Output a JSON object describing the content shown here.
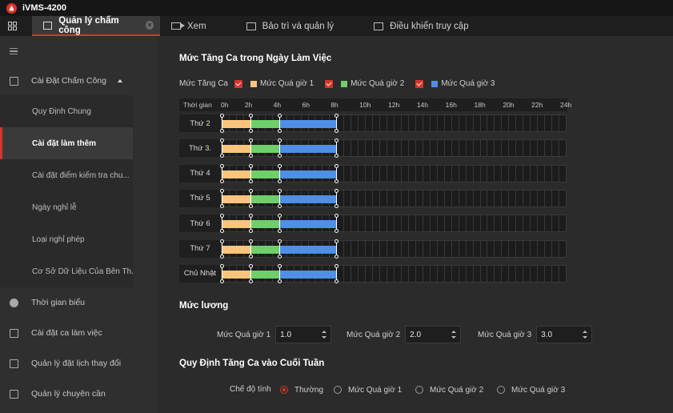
{
  "app": {
    "title": "iVMS-4200"
  },
  "tabs": [
    {
      "label": "Quản lý chấm công",
      "icon": "calendar-icon",
      "active": true
    },
    {
      "label": "Xem",
      "icon": "camera-icon"
    },
    {
      "label": "Bảo trì và quản lý",
      "icon": "maintenance-icon"
    },
    {
      "label": "Điều khiển truy cập",
      "icon": "access-control-icon"
    }
  ],
  "sidebar": {
    "groups": [
      {
        "label": "Cài Đặt Chấm Công",
        "icon": "calendar-icon",
        "expanded": true
      },
      {
        "label": "Thời gian biểu",
        "icon": "clock-icon"
      },
      {
        "label": "Cài đặt ca làm việc",
        "icon": "shift-icon"
      },
      {
        "label": "Quản lý đặt lịch thay đổi",
        "icon": "schedule-icon"
      },
      {
        "label": "Quản lý chuyên cần",
        "icon": "attendance-icon"
      }
    ],
    "sub_items": [
      {
        "label": "Quy Định Chung"
      },
      {
        "label": "Cài đặt làm thêm",
        "active": true
      },
      {
        "label": "Cài đặt điểm kiểm tra chu..."
      },
      {
        "label": "Ngày nghỉ lễ"
      },
      {
        "label": "Loại nghỉ phép"
      },
      {
        "label": "Cơ Sở Dữ Liệu Của Bên Th..."
      }
    ]
  },
  "overtime": {
    "title": "Mức Tăng Ca trong Ngày Làm Việc",
    "legend_label": "Mức Tăng Ca",
    "levels": [
      {
        "label": "Mức Quá giờ 1",
        "color": "#f9c57c",
        "checked": true
      },
      {
        "label": "Mức Quá giờ 2",
        "color": "#6fcf6a",
        "checked": true
      },
      {
        "label": "Mức Quá giờ 3",
        "color": "#4f8fe6",
        "checked": true
      }
    ],
    "axis_title": "Thời gian",
    "hours": [
      "0h",
      "2h",
      "4h",
      "6h",
      "8h",
      "10h",
      "12h",
      "14h",
      "16h",
      "18h",
      "20h",
      "22h",
      "24h"
    ],
    "days": [
      {
        "name": "Thứ 2",
        "segments": [
          [
            0,
            2,
            0
          ],
          [
            2,
            4,
            1
          ],
          [
            4,
            8,
            2
          ]
        ]
      },
      {
        "name": "Thứ 3.",
        "segments": [
          [
            0,
            2,
            0
          ],
          [
            2,
            4,
            1
          ],
          [
            4,
            8,
            2
          ]
        ]
      },
      {
        "name": "Thứ 4",
        "segments": [
          [
            0,
            2,
            0
          ],
          [
            2,
            4,
            1
          ],
          [
            4,
            8,
            2
          ]
        ]
      },
      {
        "name": "Thứ 5",
        "segments": [
          [
            0,
            2,
            0
          ],
          [
            2,
            4,
            1
          ],
          [
            4,
            8,
            2
          ]
        ]
      },
      {
        "name": "Thứ 6",
        "segments": [
          [
            0,
            2,
            0
          ],
          [
            2,
            4,
            1
          ],
          [
            4,
            8,
            2
          ]
        ]
      },
      {
        "name": "Thứ 7",
        "segments": [
          [
            0,
            2,
            0
          ],
          [
            2,
            4,
            1
          ],
          [
            4,
            8,
            2
          ]
        ]
      },
      {
        "name": "Chủ Nhật",
        "segments": [
          [
            0,
            2,
            0
          ],
          [
            2,
            4,
            1
          ],
          [
            4,
            8,
            2
          ]
        ]
      }
    ]
  },
  "wage": {
    "title": "Mức lương",
    "fields": [
      {
        "label": "Mức Quá giờ 1",
        "value": "1.0"
      },
      {
        "label": "Mức Quá giờ 2",
        "value": "2.0"
      },
      {
        "label": "Mức Quá giờ 3",
        "value": "3.0"
      }
    ]
  },
  "weekend": {
    "title": "Quy Định Tăng Ca vào Cuối Tuần",
    "mode_label": "Chế độ tính",
    "options": [
      {
        "label": "Thường",
        "selected": true
      },
      {
        "label": "Mức Quá giờ 1"
      },
      {
        "label": "Mức Quá giờ 2"
      },
      {
        "label": "Mức Quá giờ 3"
      }
    ]
  }
}
